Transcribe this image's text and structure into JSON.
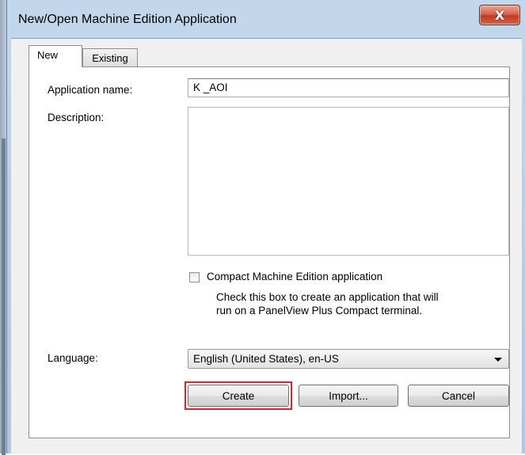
{
  "window": {
    "title": "New/Open Machine Edition Application",
    "close_symbol": "X"
  },
  "tabs": [
    {
      "label": "New",
      "selected": true
    },
    {
      "label": "Existing",
      "selected": false
    }
  ],
  "form": {
    "app_name_label": "Application name:",
    "app_name_value": "K _AOI",
    "description_label": "Description:",
    "description_value": "",
    "compact_label": "Compact Machine Edition application",
    "compact_checked": false,
    "compact_hint_line1": "Check this box to create an application that will",
    "compact_hint_line2": "run on a PanelView Plus Compact terminal.",
    "language_label": "Language:",
    "language_value": "English (United States), en-US"
  },
  "buttons": {
    "create": "Create",
    "import": "Import...",
    "cancel": "Cancel"
  },
  "colors": {
    "highlight": "#d9252b",
    "close_button": "#c13c22"
  }
}
